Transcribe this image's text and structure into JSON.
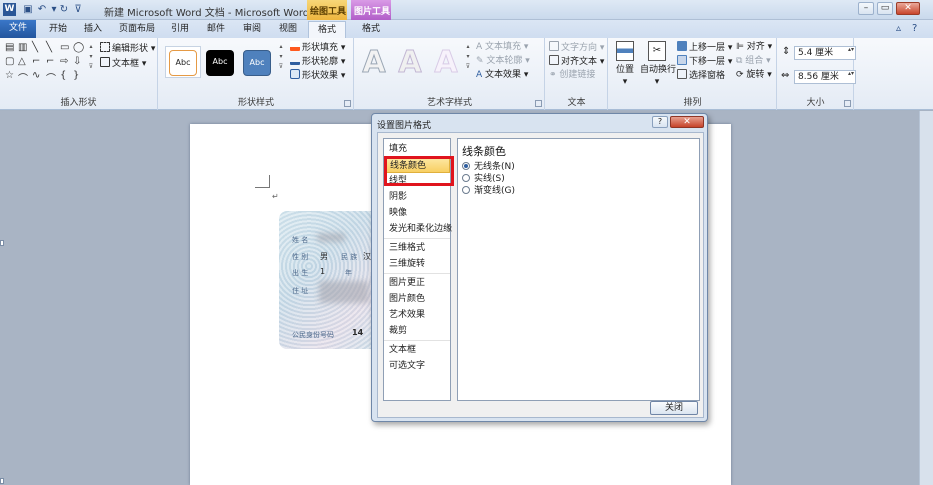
{
  "titlebar": {
    "app_icon": "W",
    "title": "新建 Microsoft Word 文档 - Microsoft Word",
    "context_drawing": "绘图工具",
    "context_picture": "图片工具",
    "minimize": "–",
    "restore": "▭",
    "close": "✕"
  },
  "tabs": {
    "file": "文件",
    "home": "开始",
    "insert": "插入",
    "layout": "页面布局",
    "references": "引用",
    "mailings": "邮件",
    "review": "审阅",
    "view": "视图",
    "format_drawing": "格式",
    "format_picture": "格式"
  },
  "ribbon": {
    "insert_shapes": {
      "label": "插入形状",
      "edit_shape": "编辑形状",
      "text_box": "文本框"
    },
    "shape_styles": {
      "label": "形状样式",
      "swatch1": "Abc",
      "swatch2": "Abc",
      "swatch3": "Abc",
      "fill": "形状填充",
      "outline": "形状轮廓",
      "effects": "形状效果"
    },
    "wordart": {
      "label": "艺术字样式",
      "text_fill": "文本填充",
      "text_outline": "文本轮廓",
      "text_effects": "文本效果"
    },
    "text": {
      "label": "文本",
      "direction": "文字方向",
      "align": "对齐文本",
      "link": "创建链接"
    },
    "arrange": {
      "label": "排列",
      "position": "位置",
      "wrap": "自动换行",
      "forward": "上移一层",
      "backward": "下移一层",
      "selection_pane": "选择窗格",
      "align": "对齐",
      "group": "组合",
      "rotate": "旋转"
    },
    "size": {
      "label": "大小",
      "height": "5.4 厘米",
      "width": "8.56 厘米"
    }
  },
  "idcard": {
    "name_label": "姓 名",
    "gender_label": "性 别",
    "gender_value": "男",
    "ethnic_label": "民 族",
    "ethnic_value": "汉",
    "birth_label": "出 生",
    "birth_year": "1",
    "birth_month": "年",
    "address_label": "住 址",
    "id_label": "公民身份号码",
    "id_value": "14"
  },
  "dialog": {
    "title": "设置图片格式",
    "help": "?",
    "close_x": "✕",
    "nav": [
      "填充",
      "线条颜色",
      "线型",
      "阴影",
      "映像",
      "发光和柔化边缘",
      "三维格式",
      "三维旋转",
      "图片更正",
      "图片颜色",
      "艺术效果",
      "裁剪",
      "文本框",
      "可选文字"
    ],
    "selected_index": 1,
    "panel_title": "线条颜色",
    "options": [
      "无线条(N)",
      "实线(S)",
      "渐变线(G)"
    ],
    "selected_option": 0,
    "close_button": "关闭"
  },
  "colors": {
    "highlight": "#e0141d",
    "selected_nav": "#f8cf63",
    "file_tab": "#2b5797"
  }
}
